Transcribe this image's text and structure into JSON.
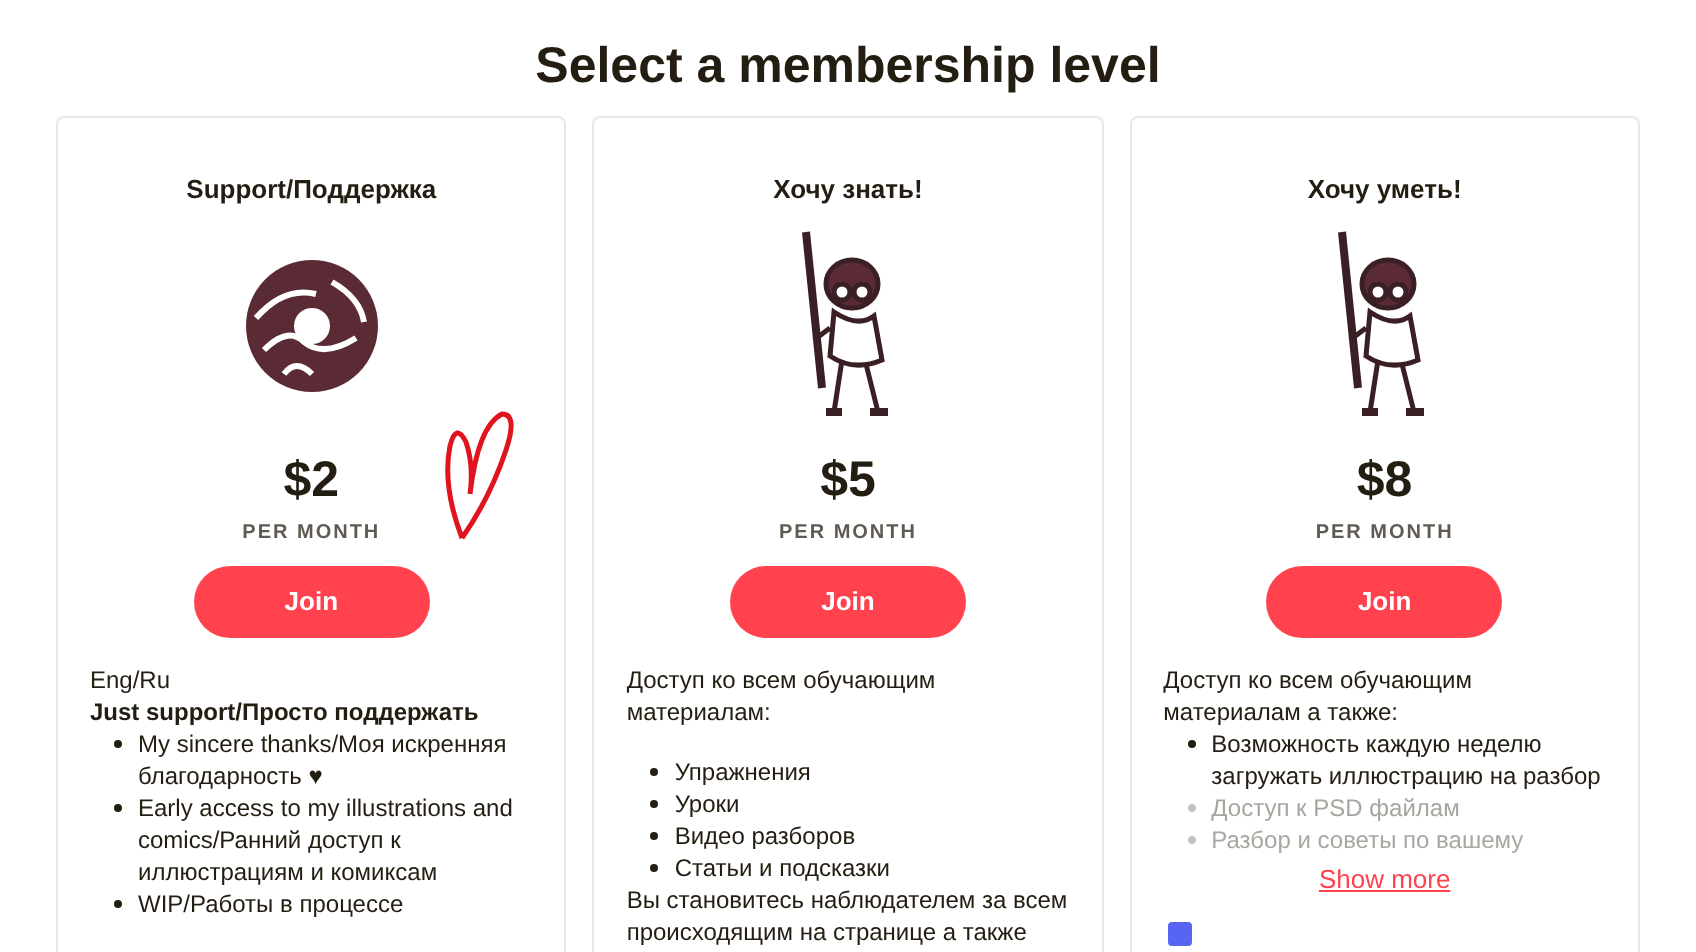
{
  "heading": "Select a membership level",
  "tiers": [
    {
      "title": "Support/Поддержка",
      "kind": "donut",
      "price": "$2",
      "period": "PER MONTH",
      "button": "Join",
      "heart": true,
      "collapsed": false,
      "blocks": [
        {
          "kind": "text",
          "text": "Eng/Ru"
        },
        {
          "kind": "bold",
          "text": "Just support/Просто поддержать"
        },
        {
          "kind": "list",
          "items": [
            "My sincere thanks/Моя искренняя благодарность ♥",
            "Early access to my illustrations and comics/Ранний доступ к иллюстрациям и комиксам",
            "WIP/Работы в процессе"
          ]
        }
      ]
    },
    {
      "title": "Хочу знать!",
      "kind": "character",
      "price": "$5",
      "period": "PER MONTH",
      "button": "Join",
      "heart": false,
      "collapsed": false,
      "blocks": [
        {
          "kind": "text",
          "text": "Доступ ко всем обучающим материалам:"
        },
        {
          "kind": "gap"
        },
        {
          "kind": "list",
          "items": [
            "Упражнения",
            "Уроки",
            "Видео разборов",
            "Статьи и подсказки"
          ]
        },
        {
          "kind": "text",
          "text": "Вы становитесь наблюдателем за всем происходящим на странице а также"
        }
      ]
    },
    {
      "title": "Хочу уметь!",
      "kind": "character",
      "price": "$8",
      "period": "PER MONTH",
      "button": "Join",
      "heart": false,
      "collapsed": true,
      "show_more": "Show more",
      "blocks": [
        {
          "kind": "text",
          "text": "Доступ ко всем обучающим материалам а также:"
        },
        {
          "kind": "list",
          "items": [
            "Возможность каждую неделю загружать иллюстрацию на разбор",
            "Доступ к PSD файлам",
            "Разбор и советы по вашему"
          ]
        }
      ]
    }
  ]
}
